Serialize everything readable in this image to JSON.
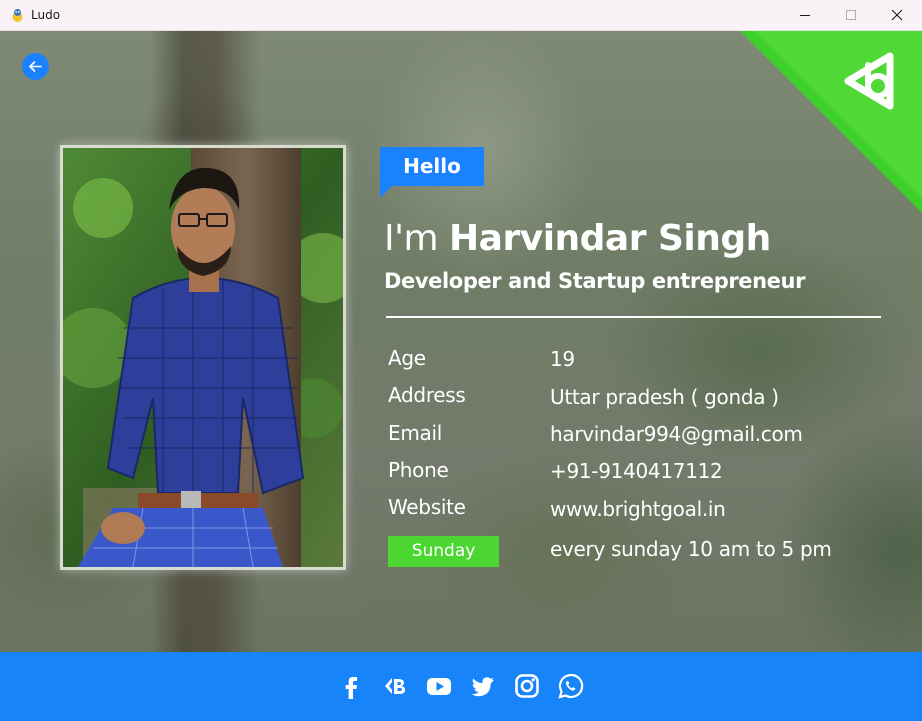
{
  "window": {
    "title": "Ludo",
    "app_icon": "pygame-snake-icon",
    "controls": [
      "minimize-icon",
      "maximize-icon",
      "close-icon"
    ]
  },
  "header": {
    "back_icon": "arrow-left-icon",
    "brand_icon": "brightgoal-logo-icon"
  },
  "profile": {
    "greeting": "Hello",
    "name_prefix": "I'm",
    "name": "Harvindar Singh",
    "role": "Developer and Startup entrepreneur",
    "photo_alt": "profile photo"
  },
  "info": [
    {
      "label": "Age",
      "value": "19"
    },
    {
      "label": "Address",
      "value": "Uttar pradesh ( gonda )"
    },
    {
      "label": "Email",
      "value": "harvindar994@gmail.com"
    },
    {
      "label": "Phone",
      "value": "+91-9140417112"
    },
    {
      "label": "Website",
      "value": "www.brightgoal.in"
    }
  ],
  "schedule": {
    "badge": "Sunday",
    "text": "every sunday 10 am to 5 pm"
  },
  "footer": {
    "social_icons": [
      "facebook-icon",
      "vk-icon",
      "youtube-icon",
      "twitter-icon",
      "instagram-icon",
      "whatsapp-icon"
    ]
  },
  "colors": {
    "accent_blue": "#1a82ff",
    "footer_blue": "#1784f9",
    "badge_green": "#4cd631",
    "corner_green": "#3ecf2a"
  }
}
